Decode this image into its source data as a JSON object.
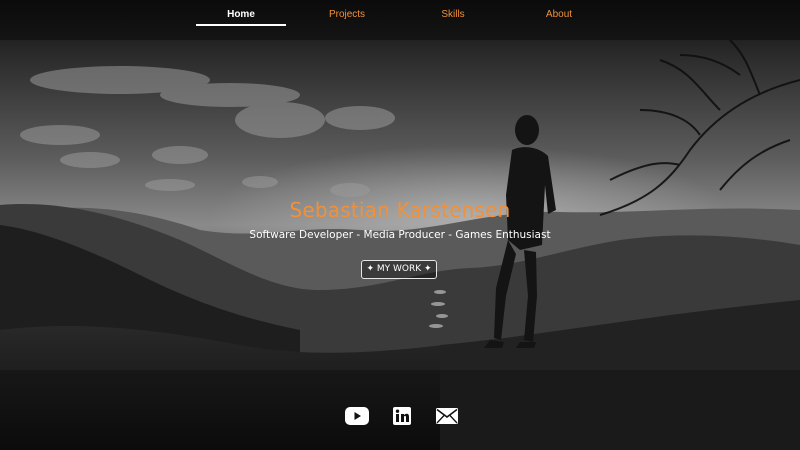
{
  "nav": {
    "items": [
      {
        "label": "Home",
        "active": true
      },
      {
        "label": "Projects",
        "active": false
      },
      {
        "label": "Skills",
        "active": false
      },
      {
        "label": "About",
        "active": false
      }
    ],
    "accent_color": "#f0913a"
  },
  "hero": {
    "name": "Sebastian Karstensen",
    "tagline": "Software Developer - Media Producer - Games Enthusiast",
    "cta_label": "MY WORK",
    "cta_decoration": "✦"
  },
  "social": [
    {
      "icon": "youtube-icon"
    },
    {
      "icon": "linkedin-icon"
    },
    {
      "icon": "email-icon"
    }
  ]
}
